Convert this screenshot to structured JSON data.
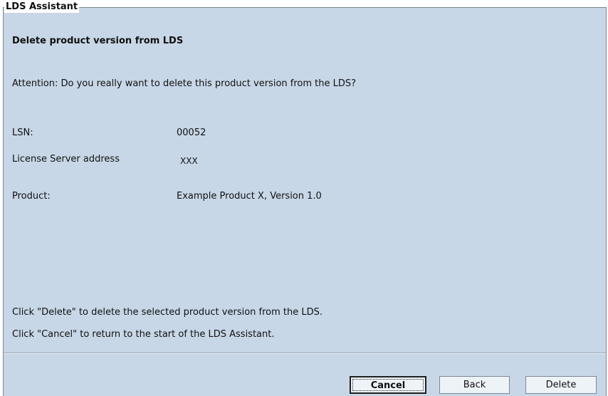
{
  "group_title": "LDS Assistant",
  "heading": "Delete product version from LDS",
  "attention": "Attention: Do you really want to delete this product version from the LDS?",
  "fields": [
    {
      "label": "LSN:",
      "value": "00052"
    },
    {
      "label": "License Server address",
      "value": "XXX"
    },
    {
      "label": "Product:",
      "value": "Example Product X, Version 1.0"
    }
  ],
  "instructions": [
    "Click \"Delete\" to delete the selected product version from the LDS.",
    "Click \"Cancel\" to return to the start of the LDS Assistant."
  ],
  "buttons": {
    "cancel": "Cancel",
    "back": "Back",
    "delete": "Delete"
  }
}
